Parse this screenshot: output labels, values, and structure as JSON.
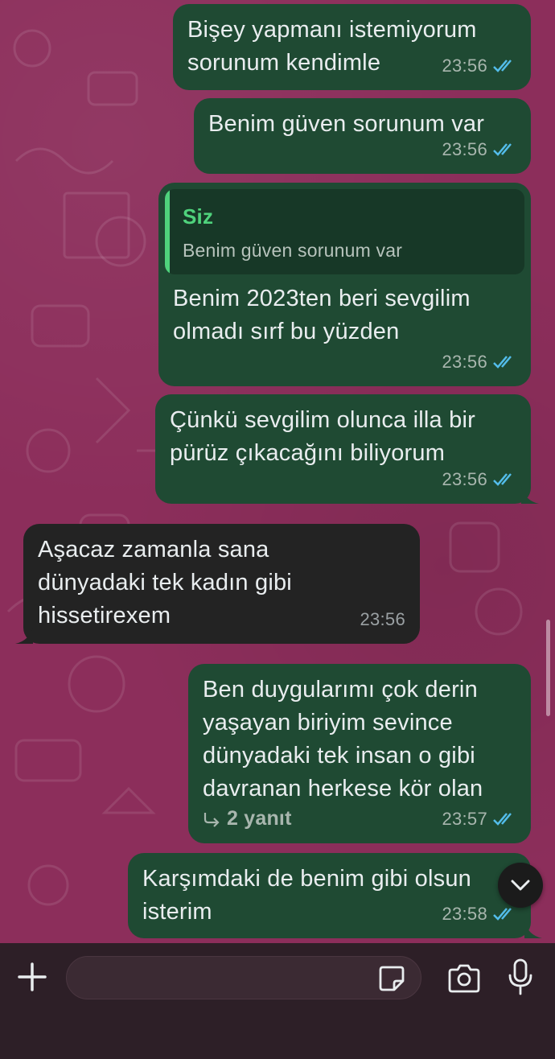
{
  "messages": [
    {
      "direction": "out",
      "text": "Bişey yapmanı istemiyorum\nsorunum kendimle",
      "time": "23:56"
    },
    {
      "direction": "out",
      "text": "Benim güven sorunum var",
      "time": "23:56"
    },
    {
      "direction": "out",
      "quote_author": "Siz",
      "quote_text": "Benim güven sorunum var",
      "text": "Benim 2023ten beri sevgilim\nolmadı sırf bu yüzden",
      "time": "23:56"
    },
    {
      "direction": "out",
      "text": "Çünkü sevgilim olunca illa bir\npürüz çıkacağını biliyorum",
      "time": "23:56"
    },
    {
      "direction": "in",
      "text": "Aşacaz zamanla sana\ndünyadaki tek kadın gibi\nhissetirexem",
      "time": "23:56"
    },
    {
      "direction": "out",
      "text": "Ben duygularımı çok derin\nyaşayan biriyim sevince\ndünyadaki tek insan o gibi\ndavranan herkese kör olan",
      "replies": "2 yanıt",
      "time": "23:57"
    },
    {
      "direction": "out",
      "text": "Karşımdaki de benim gibi olsun\nisterim",
      "time": "23:58"
    }
  ],
  "composer": {
    "placeholder": ""
  },
  "colors": {
    "outgoing": "#1f4a33",
    "incoming": "#232323",
    "quote_accent": "#4fd27c",
    "read_ticks": "#53bdeb"
  },
  "icons": [
    "plus-icon",
    "sticker-icon",
    "camera-icon",
    "mic-icon",
    "chevron-down-icon",
    "double-check-icon",
    "reply-arrow-icon"
  ]
}
